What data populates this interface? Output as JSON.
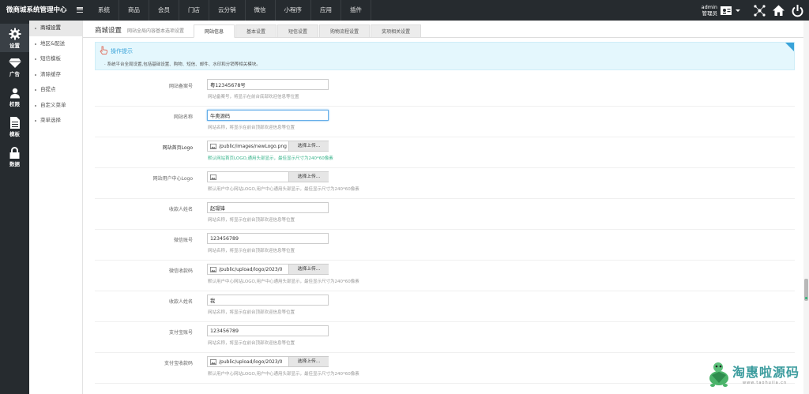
{
  "app": {
    "title": "微商城系统管理中心"
  },
  "topnav": [
    "系统",
    "商品",
    "会员",
    "门店",
    "云分销",
    "微信",
    "小程序",
    "应用",
    "插件"
  ],
  "admin": {
    "name": "admin",
    "role": "管理员"
  },
  "leftbar": [
    {
      "label": "设置",
      "icon": "gear-icon"
    },
    {
      "label": "广告",
      "icon": "diamond-icon"
    },
    {
      "label": "权限",
      "icon": "user-icon"
    },
    {
      "label": "模板",
      "icon": "document-icon"
    },
    {
      "label": "数据",
      "icon": "lock-icon"
    }
  ],
  "subbar": [
    "商城设置",
    "地区&配送",
    "短信模板",
    "清除缓存",
    "自提点",
    "自定义菜单",
    "菜单选择"
  ],
  "header": {
    "title": "商城设置",
    "subtitle": "网站全局内容基本选项设置",
    "tabs": [
      "网站信息",
      "基本设置",
      "短信设置",
      "购物流程设置",
      "奖项相关设置"
    ]
  },
  "tips": {
    "title": "操作提示",
    "text": "系统平台全局设置,包括基础设置、购物、短信、邮件、水印和分销等相关模块。"
  },
  "form": [
    {
      "label": "网站备案号",
      "type": "text",
      "value": "粤12345678号",
      "hint": "网站备案号，将显示在前台底部欢迎信息等位置"
    },
    {
      "label": "网站名称",
      "type": "text",
      "value": "牛奥源码",
      "hint": "网站名称，将显示在前台顶部欢迎信息等位置"
    },
    {
      "label": "网站首页Logo",
      "type": "file",
      "value": "/public/images/newLogo.png",
      "button": "选择上传...",
      "hint": "默认网站首页LOGO,通用头部显示，最佳显示尺寸为240*60像素"
    },
    {
      "label": "网站用户中心Logo",
      "type": "file",
      "value": "",
      "button": "选择上传...",
      "hint": "默认用户中心网站LOGO,用户中心通用头部显示，最佳显示尺寸为240*60像素"
    },
    {
      "label": "收款人姓名",
      "type": "text",
      "value": "赵璟锋",
      "hint": "网站名称，将显示在前台顶部欢迎信息等位置"
    },
    {
      "label": "微信账号",
      "type": "text",
      "value": "123456789",
      "hint": "网站名称，将显示在前台顶部欢迎信息等位置"
    },
    {
      "label": "微信收款码",
      "type": "file",
      "value": "/public/upload/logo/2023/0",
      "button": "选择上传...",
      "hint": "默认用户中心网站LOGO,用户中心通用头部显示，最佳显示尺寸为240*60像素"
    },
    {
      "label": "收款人姓名",
      "type": "text",
      "value": "我",
      "hint": "网站名称，将显示在前台顶部欢迎信息等位置"
    },
    {
      "label": "支付宝账号",
      "type": "text",
      "value": "123456789",
      "hint": "网站名称，将显示在前台顶部欢迎信息等位置"
    },
    {
      "label": "支付宝收款码",
      "type": "file",
      "value": "/public/upload/logo/2023/0",
      "button": "选择上传...",
      "hint": "默认用户中心网站LOGO,用户中心通用头部显示，最佳显示尺寸为240*60像素"
    }
  ],
  "watermark": {
    "text": "淘惠啦源码",
    "sub": "www.taohuila.cn"
  }
}
